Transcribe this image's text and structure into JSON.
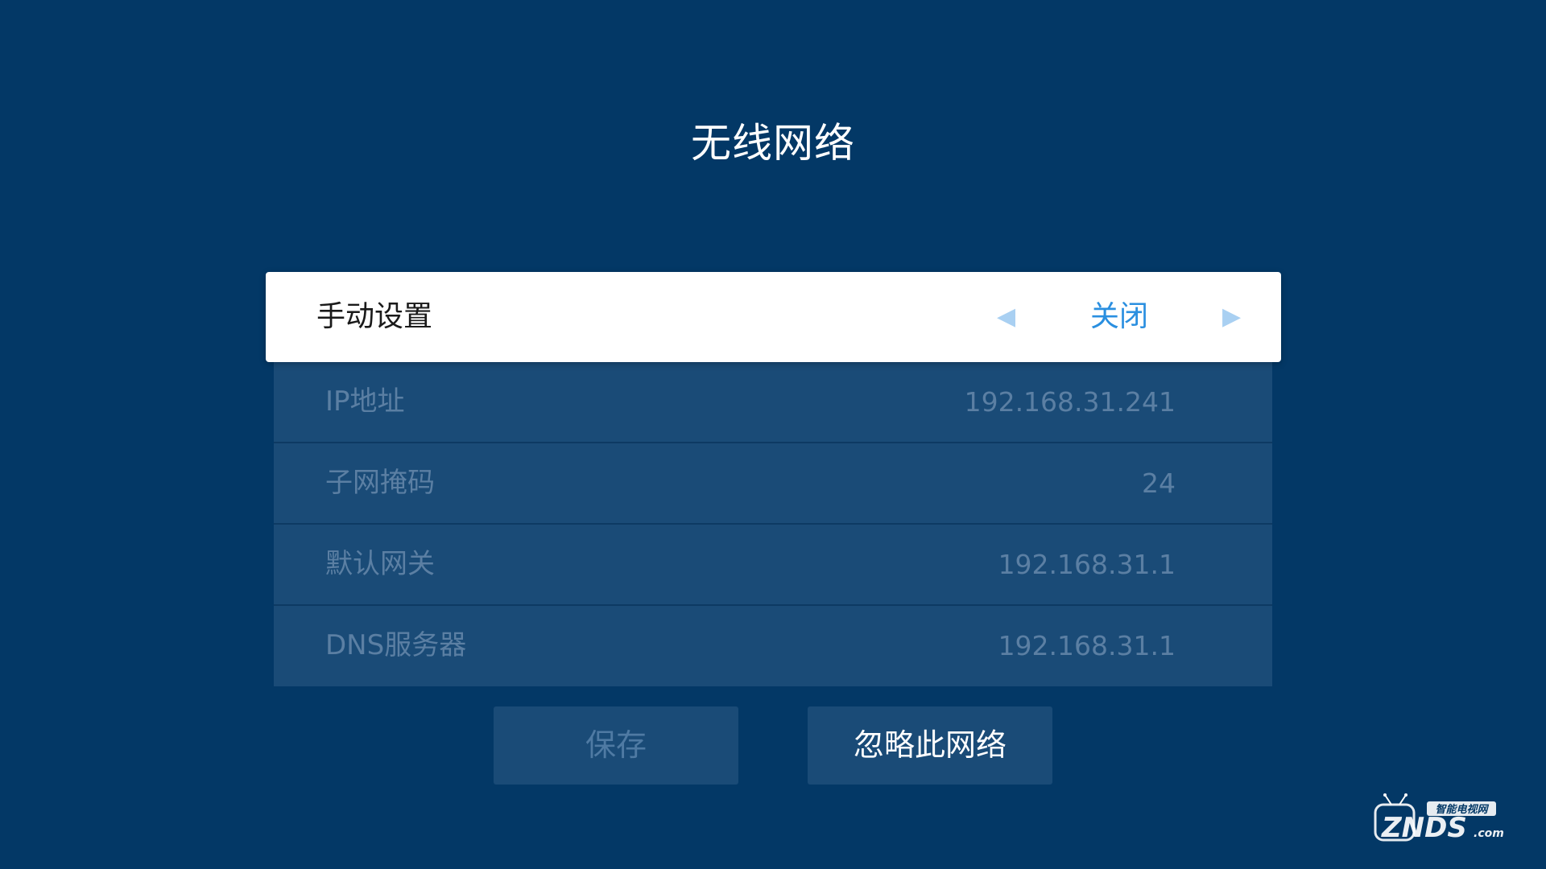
{
  "header": {
    "title": "无线网络"
  },
  "manual_setting": {
    "label": "手动设置",
    "value": "关闭",
    "left_arrow": "◀",
    "right_arrow": "▶"
  },
  "network_info": [
    {
      "label": "IP地址",
      "value": "192.168.31.241"
    },
    {
      "label": "子网掩码",
      "value": "24"
    },
    {
      "label": "默认网关",
      "value": "192.168.31.1"
    },
    {
      "label": "DNS服务器",
      "value": "192.168.31.1"
    }
  ],
  "buttons": {
    "save_label": "保存",
    "forget_label": "忽略此网络"
  },
  "watermark": {
    "brand": "ZNDS",
    "suffix": ".com",
    "tagline": "智能电视网"
  },
  "colors": {
    "background": "#033866",
    "row_background": "#1a4b77",
    "accent": "#2a8fe0",
    "disabled_text": "#5b7fa3"
  }
}
